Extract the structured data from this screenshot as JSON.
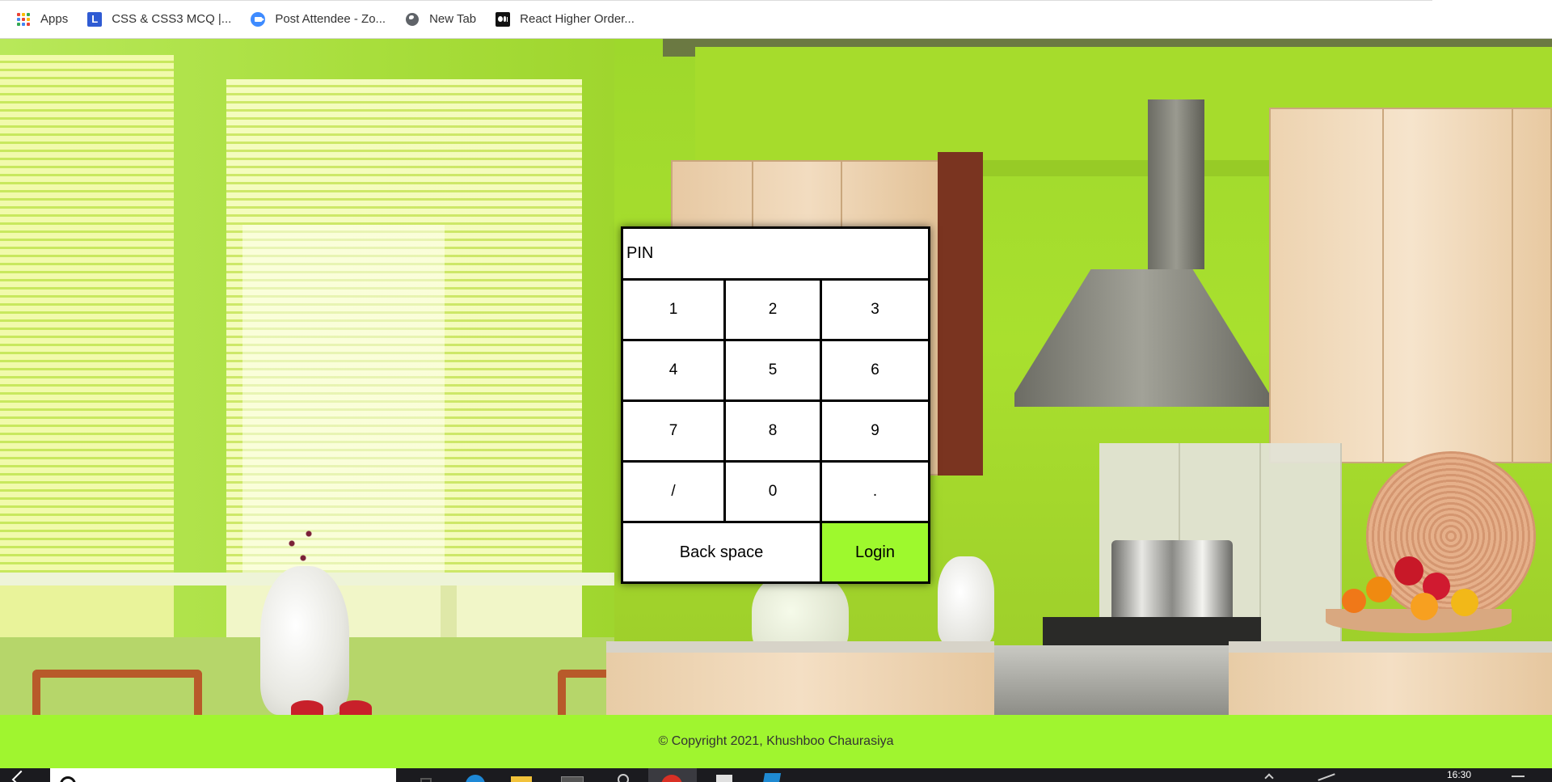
{
  "bookmarks": [
    {
      "label": "Apps",
      "icon": "apps-grid-icon"
    },
    {
      "label": "CSS & CSS3 MCQ |...",
      "icon": "l-logo-icon"
    },
    {
      "label": "Post Attendee - Zo...",
      "icon": "zoom-video-icon"
    },
    {
      "label": "New Tab",
      "icon": "globe-icon"
    },
    {
      "label": "React Higher Order...",
      "icon": "medium-logo-icon"
    }
  ],
  "colors": {
    "scene_green": "#a9e02e",
    "login_green": "#9ef92d",
    "footer_green": "#a0f52f",
    "taskbar": "#1b1b1f"
  },
  "pinpad": {
    "display_label": "PIN",
    "keys": [
      "1",
      "2",
      "3",
      "4",
      "5",
      "6",
      "7",
      "8",
      "9",
      "/",
      "0",
      "."
    ],
    "backspace_label": "Back space",
    "login_label": "Login"
  },
  "footer": {
    "copyright": "© Copyright 2021, Khushboo Chaurasiya"
  },
  "taskbar": {
    "clock": "16:30"
  }
}
